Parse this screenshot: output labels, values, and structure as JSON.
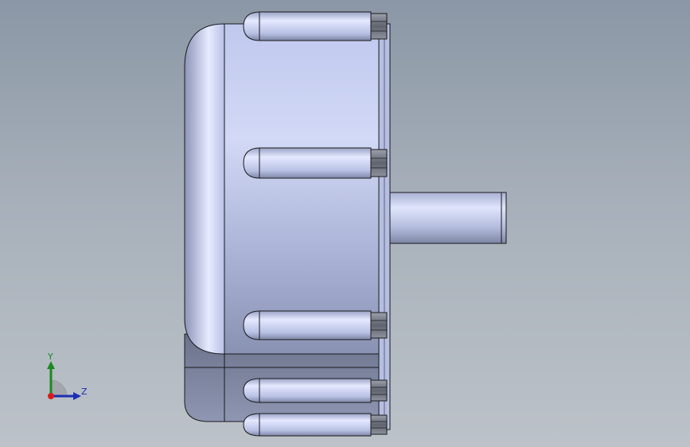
{
  "viewport": {
    "background_top": "#8b97a6",
    "background_bottom": "#bcc2c8"
  },
  "model": {
    "body_color": "#c6cef0",
    "shadow_color": "#5c6478",
    "bolt_color": "#6f7580",
    "edge_color": "#1a1a1a"
  },
  "triad": {
    "y_label": "Y",
    "z_label": "Z",
    "y_color": "#1a8a22",
    "z_color": "#1b2fb3",
    "x_color": "#d61d1d"
  }
}
